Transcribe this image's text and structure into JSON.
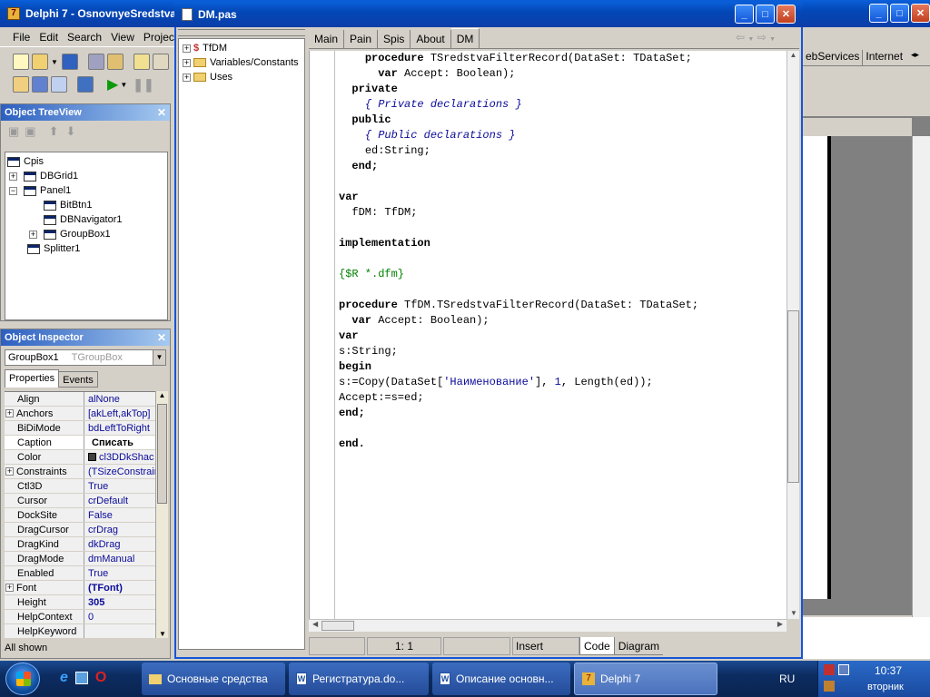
{
  "main_window": {
    "title": "Delphi 7 - OsnovnyeSredstva",
    "menu": [
      "File",
      "Edit",
      "Search",
      "View",
      "Projec"
    ],
    "right_tabs": [
      "ebServices",
      "Internet"
    ]
  },
  "object_treeview": {
    "title": "Object TreeView",
    "items": [
      {
        "label": "Cpis",
        "level": 0,
        "expand": ""
      },
      {
        "label": "DBGrid1",
        "level": 1,
        "expand": "+"
      },
      {
        "label": "Panel1",
        "level": 1,
        "expand": "-"
      },
      {
        "label": "BitBtn1",
        "level": 2,
        "expand": ""
      },
      {
        "label": "DBNavigator1",
        "level": 2,
        "expand": ""
      },
      {
        "label": "GroupBox1",
        "level": 2,
        "expand": "+"
      },
      {
        "label": "Splitter1",
        "level": 1,
        "expand": ""
      }
    ]
  },
  "object_inspector": {
    "title": "Object Inspector",
    "selected_object": "GroupBox1",
    "selected_type": "TGroupBox",
    "tabs": [
      "Properties",
      "Events"
    ],
    "status": "All shown",
    "properties": [
      {
        "name": "Align",
        "value": "alNone",
        "expand": ""
      },
      {
        "name": "Anchors",
        "value": "[akLeft,akTop]",
        "expand": "+"
      },
      {
        "name": "BiDiMode",
        "value": "bdLeftToRight",
        "expand": ""
      },
      {
        "name": "Caption",
        "value": "Списать",
        "expand": "",
        "selected": true
      },
      {
        "name": "Color",
        "value": "cl3DDkShac",
        "expand": ""
      },
      {
        "name": "Constraints",
        "value": "(TSizeConstrain",
        "expand": "+"
      },
      {
        "name": "Ctl3D",
        "value": "True",
        "expand": ""
      },
      {
        "name": "Cursor",
        "value": "crDefault",
        "expand": ""
      },
      {
        "name": "DockSite",
        "value": "False",
        "expand": ""
      },
      {
        "name": "DragCursor",
        "value": "crDrag",
        "expand": ""
      },
      {
        "name": "DragKind",
        "value": "dkDrag",
        "expand": ""
      },
      {
        "name": "DragMode",
        "value": "dmManual",
        "expand": ""
      },
      {
        "name": "Enabled",
        "value": "True",
        "expand": ""
      },
      {
        "name": "Font",
        "value": "(TFont)",
        "expand": "+",
        "bold": true
      },
      {
        "name": "Height",
        "value": "305",
        "expand": "",
        "bold": true
      },
      {
        "name": "HelpContext",
        "value": "0",
        "expand": ""
      },
      {
        "name": "HelpKeyword",
        "value": "",
        "expand": ""
      }
    ]
  },
  "editor": {
    "title": "DM.pas",
    "explorer": [
      "TfDM",
      "Variables/Constants",
      "Uses"
    ],
    "tabs": [
      "Main",
      "Pain",
      "Spis",
      "About",
      "DM"
    ],
    "active_tab": "DM",
    "status_position": "1:   1",
    "status_mode": "Insert",
    "bottom_tabs": [
      "Code",
      "Diagram"
    ],
    "code_lines": [
      {
        "indent": 4,
        "parts": [
          {
            "t": "procedure",
            "c": "kw"
          },
          {
            "t": " TSredstvaFilterRecord(DataSet: TDataSet;",
            "c": ""
          }
        ]
      },
      {
        "indent": 6,
        "parts": [
          {
            "t": "var",
            "c": "kw"
          },
          {
            "t": " Accept: Boolean);",
            "c": ""
          }
        ]
      },
      {
        "indent": 2,
        "parts": [
          {
            "t": "private",
            "c": "kw"
          }
        ]
      },
      {
        "indent": 4,
        "parts": [
          {
            "t": "{ Private declarations }",
            "c": "cm"
          }
        ]
      },
      {
        "indent": 2,
        "parts": [
          {
            "t": "public",
            "c": "kw"
          }
        ]
      },
      {
        "indent": 4,
        "parts": [
          {
            "t": "{ Public declarations }",
            "c": "cm"
          }
        ]
      },
      {
        "indent": 4,
        "parts": [
          {
            "t": "ed:String;",
            "c": ""
          }
        ]
      },
      {
        "indent": 2,
        "parts": [
          {
            "t": "end;",
            "c": "kw"
          }
        ]
      },
      {
        "indent": 0,
        "parts": []
      },
      {
        "indent": 0,
        "parts": [
          {
            "t": "var",
            "c": "kw"
          }
        ]
      },
      {
        "indent": 2,
        "parts": [
          {
            "t": "fDM: TfDM;",
            "c": ""
          }
        ]
      },
      {
        "indent": 0,
        "parts": []
      },
      {
        "indent": 0,
        "parts": [
          {
            "t": "implementation",
            "c": "kw"
          }
        ]
      },
      {
        "indent": 0,
        "parts": []
      },
      {
        "indent": 0,
        "parts": [
          {
            "t": "{$R *.dfm}",
            "c": "dir"
          }
        ]
      },
      {
        "indent": 0,
        "parts": []
      },
      {
        "indent": 0,
        "parts": [
          {
            "t": "procedure",
            "c": "kw"
          },
          {
            "t": " TfDM.TSredstvaFilterRecord(DataSet: TDataSet;",
            "c": ""
          }
        ]
      },
      {
        "indent": 2,
        "parts": [
          {
            "t": "var",
            "c": "kw"
          },
          {
            "t": " Accept: Boolean);",
            "c": ""
          }
        ]
      },
      {
        "indent": 0,
        "parts": [
          {
            "t": "var",
            "c": "kw"
          }
        ]
      },
      {
        "indent": 0,
        "parts": [
          {
            "t": "s:String;",
            "c": ""
          }
        ]
      },
      {
        "indent": 0,
        "parts": [
          {
            "t": "begin",
            "c": "kw"
          }
        ]
      },
      {
        "indent": 0,
        "parts": [
          {
            "t": "s:=Copy(DataSet[",
            "c": ""
          },
          {
            "t": "'Наименование'",
            "c": "str"
          },
          {
            "t": "], ",
            "c": ""
          },
          {
            "t": "1",
            "c": "str"
          },
          {
            "t": ", Length(ed));",
            "c": ""
          }
        ]
      },
      {
        "indent": 0,
        "parts": [
          {
            "t": "Accept:=s=ed;",
            "c": ""
          }
        ]
      },
      {
        "indent": 0,
        "parts": [
          {
            "t": "end;",
            "c": "kw"
          }
        ]
      },
      {
        "indent": 0,
        "parts": []
      },
      {
        "indent": 0,
        "parts": [
          {
            "t": "end.",
            "c": "kw"
          }
        ]
      }
    ]
  },
  "taskbar": {
    "start_label": "",
    "items": [
      {
        "label": "Основные средства",
        "active": false
      },
      {
        "label": "Регистратура.do...",
        "active": false
      },
      {
        "label": "Описание основн...",
        "active": false
      },
      {
        "label": "Delphi 7",
        "active": true
      }
    ],
    "lang": "RU",
    "time": "10:37",
    "day": "вторник"
  }
}
